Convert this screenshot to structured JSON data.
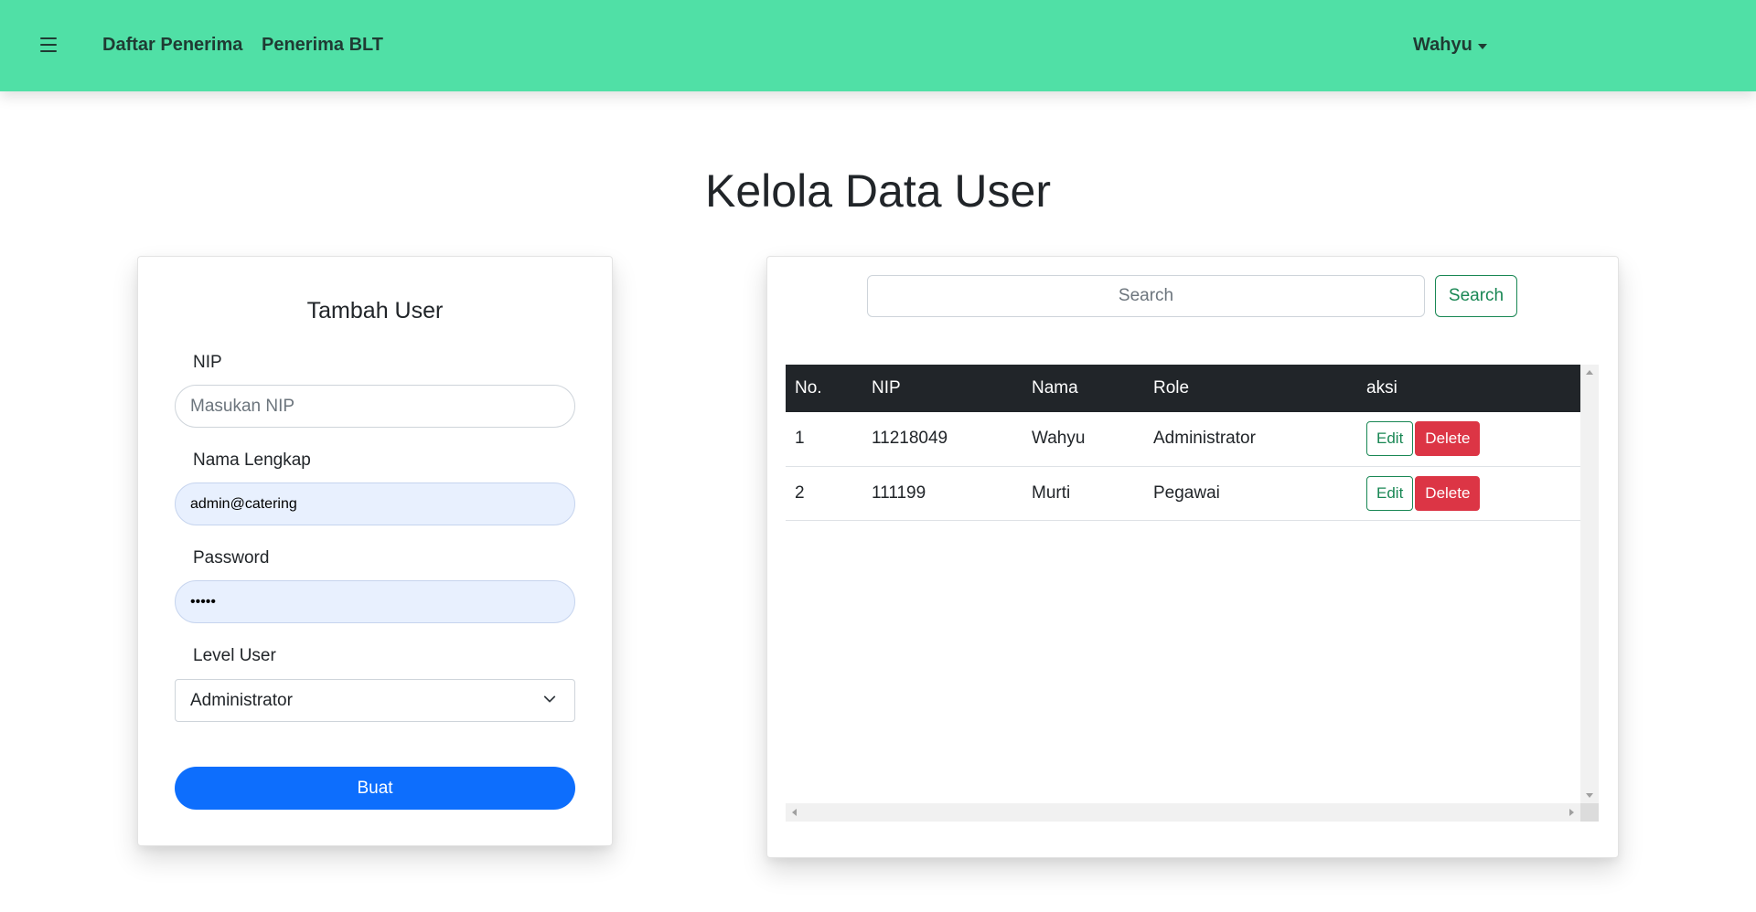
{
  "navbar": {
    "links": [
      "Daftar Penerima",
      "Penerima BLT"
    ],
    "user": "Wahyu",
    "bg_color": "#50e0a6"
  },
  "page": {
    "title": "Kelola Data User"
  },
  "form": {
    "title": "Tambah User",
    "nip": {
      "label": "NIP",
      "placeholder": "Masukan NIP",
      "value": ""
    },
    "nama": {
      "label": "Nama Lengkap",
      "value": "admin@catering"
    },
    "password": {
      "label": "Password",
      "value": "•••••"
    },
    "level": {
      "label": "Level User",
      "selected": "Administrator"
    },
    "submit_label": "Buat",
    "submit_color": "#0d6efd"
  },
  "search": {
    "placeholder": "Search",
    "button_label": "Search"
  },
  "table": {
    "headers": [
      "No.",
      "NIP",
      "Nama",
      "Role",
      "aksi"
    ],
    "rows": [
      {
        "no": "1",
        "nip": "11218049",
        "nama": "Wahyu",
        "role": "Administrator"
      },
      {
        "no": "2",
        "nip": "111199",
        "nama": "Murti",
        "role": "Pegawai"
      }
    ],
    "edit_label": "Edit",
    "delete_label": "Delete"
  },
  "icons": {
    "menu": "hamburger-icon",
    "dropdown": "caret-down-icon",
    "select": "chevron-down-icon"
  }
}
